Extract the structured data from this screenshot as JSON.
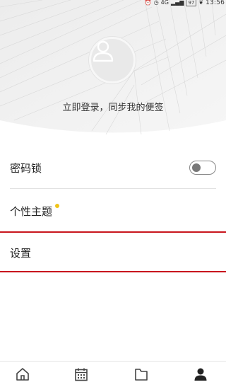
{
  "status_bar": {
    "icons": [
      "alarm-icon",
      "clock-icon",
      "signal-4g-icon",
      "signal-bars-icon",
      "battery-icon",
      "leaf-icon"
    ],
    "network_label": "4G",
    "battery_label": "97",
    "time": "13:56"
  },
  "header": {
    "avatar_icon": "user-icon",
    "login_prompt": "立即登录，同步我的便签"
  },
  "settings": {
    "password_lock": {
      "label": "密码锁",
      "enabled": false
    },
    "theme": {
      "label": "个性主题",
      "badge_color": "#f0c419"
    },
    "settings": {
      "label": "设置",
      "highlight_color": "#c8161d"
    }
  },
  "bottom_nav": {
    "items": [
      {
        "icon": "home-icon",
        "active": false
      },
      {
        "icon": "calendar-icon",
        "active": false
      },
      {
        "icon": "folder-icon",
        "active": false
      },
      {
        "icon": "profile-icon",
        "active": true
      }
    ]
  }
}
